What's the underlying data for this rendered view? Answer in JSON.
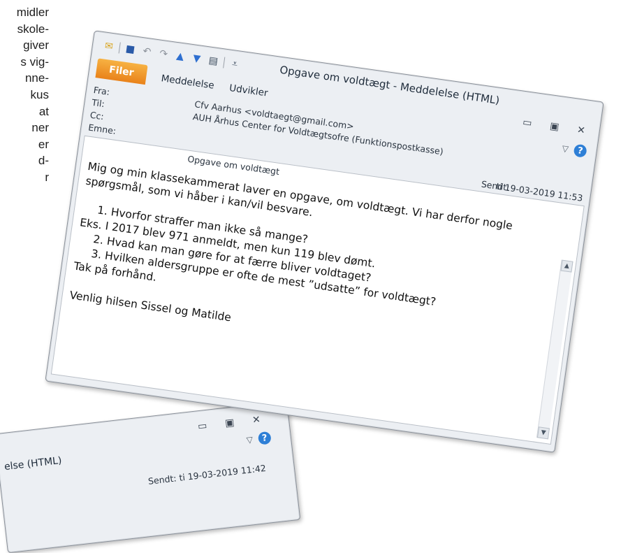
{
  "background_text": [
    "midler",
    "skole-",
    "giver",
    "s vig-",
    "nne-",
    "kus",
    "at",
    "ner",
    "er",
    "d-",
    "r"
  ],
  "window": {
    "title": "Opgave om voldtægt  -  Meddelelse (HTML)",
    "tabs": {
      "file": "Filer",
      "message": "Meddelelse",
      "developer": "Udvikler"
    },
    "header": {
      "from_label": "Fra:",
      "from_value": "Cfv Aarhus <voldtaegt@gmail.com>",
      "to_label": "Til:",
      "to_value": "AUH Århus Center for Voldtægtsofre (Funktionspostkasse)",
      "cc_label": "Cc:",
      "subject_label": "Emne:",
      "subject_value": "Opgave om voldtægt",
      "sent_label": "Sendt:",
      "sent_value": "ti 19-03-2019 11:53"
    },
    "message": {
      "intro": "Mig og  min klassekammerat laver en opgave, om voldtægt. Vi har derfor nogle spørgsmål, som vi håber i kan/vil besvare.",
      "q1": "Hvorfor straffer man ikke så mange?",
      "q1_note": "Eks. I 2017 blev 971 anmeldt, men kun 119 blev dømt.",
      "q2": "Hvad kan man gøre for at færre bliver voldtaget?",
      "q3": "Hvilken aldersgruppe er ofte de mest ”udsatte” for voldtægt?",
      "thanks": "Tak på forhånd.",
      "signoff": "Venlig hilsen Sissel og Matilde"
    }
  },
  "window2": {
    "title_fragment": "else (HTML)",
    "sent_label": "Sendt:",
    "sent_value": "ti 19-03-2019 11:42"
  },
  "icons": [
    "envelope-icon",
    "save-icon",
    "undo-icon",
    "redo-icon",
    "up-arrow-icon",
    "down-arrow-icon",
    "print-preview-icon",
    "customize-icon",
    "minimize-icon",
    "maximize-icon",
    "close-icon",
    "chevron-icon",
    "help-icon"
  ]
}
